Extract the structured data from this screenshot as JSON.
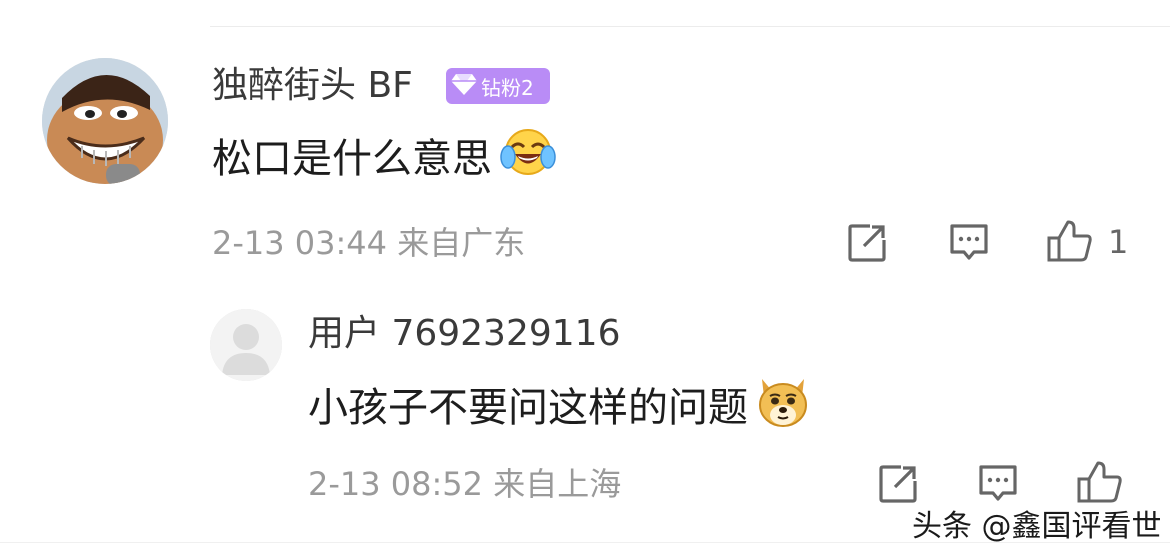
{
  "comment": {
    "username": "独醉街头 BF",
    "badge": {
      "label": "钻粉2",
      "color": "#b98cf6"
    },
    "text": "松口是什么意思",
    "emoji": "laughing-tears-emoji",
    "timestamp": "2-13 03:44",
    "location": "来自广东",
    "like_count": "1"
  },
  "reply": {
    "username": "用户 7692329116",
    "text": "小孩子不要问这样的问题",
    "emoji": "doge-emoji",
    "timestamp": "2-13 08:52",
    "location": "来自上海",
    "like_count": ""
  },
  "actions": [
    "share-icon",
    "comment-icon",
    "like-icon"
  ],
  "watermark": "头条 @鑫国评看世"
}
